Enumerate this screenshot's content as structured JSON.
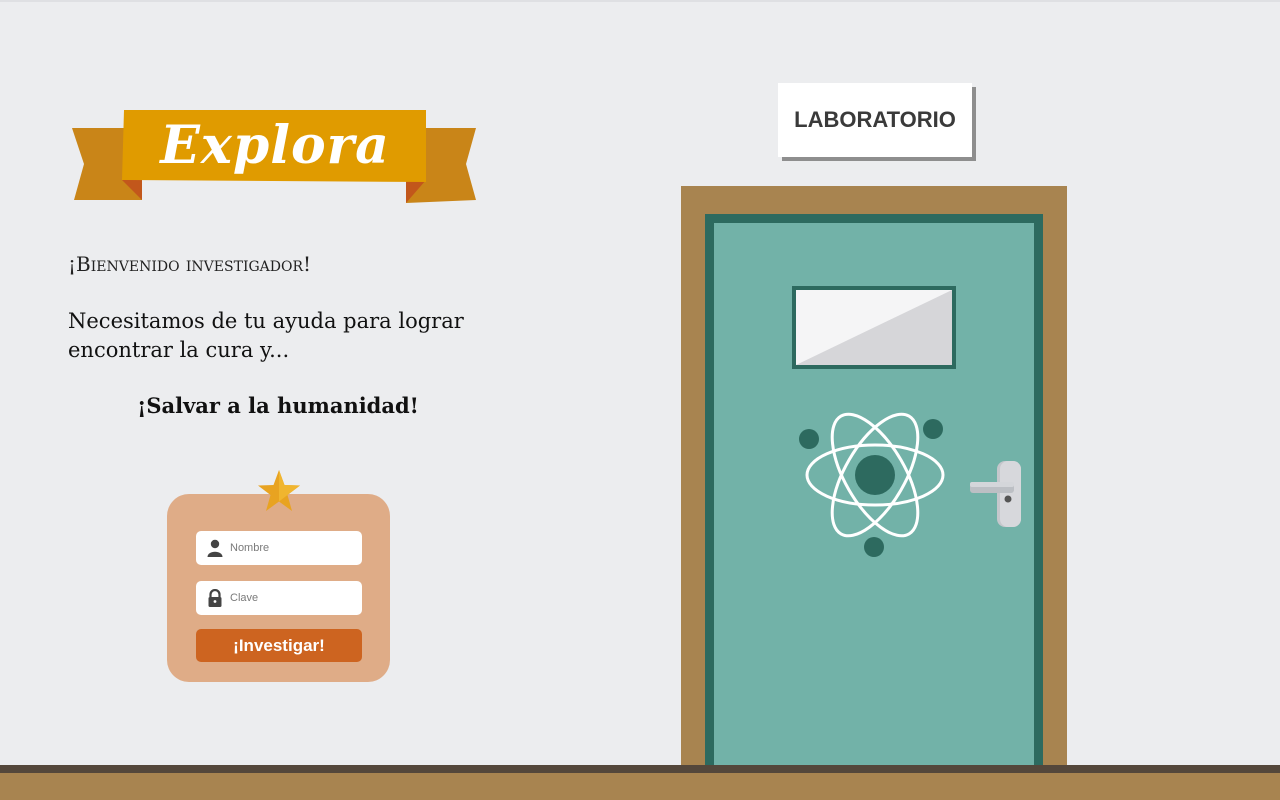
{
  "banner": {
    "title": "Explora"
  },
  "welcome": "¡Bienvenido investigador!",
  "intro": "Necesitamos de tu ayuda para lograr encontrar la cura y...",
  "cta_text": "¡Salvar a la humanidad!",
  "login": {
    "name_placeholder": "Nombre",
    "password_placeholder": "Clave",
    "submit_label": "¡Investigar!"
  },
  "sign": {
    "label": "LABORATORIO"
  },
  "icons": {
    "star": "star-icon",
    "user": "user-icon",
    "lock": "lock-icon",
    "atom": "atom-icon",
    "handle": "door-handle"
  },
  "colors": {
    "background": "#ecedef",
    "banner": "#e09b00",
    "banner_ribbon": "#c98518",
    "card": "#dfac87",
    "button": "#cd6420",
    "door": "#72b2a8",
    "door_border": "#2d6a5f",
    "frame": "#a88450",
    "floor_line": "#54473b"
  }
}
